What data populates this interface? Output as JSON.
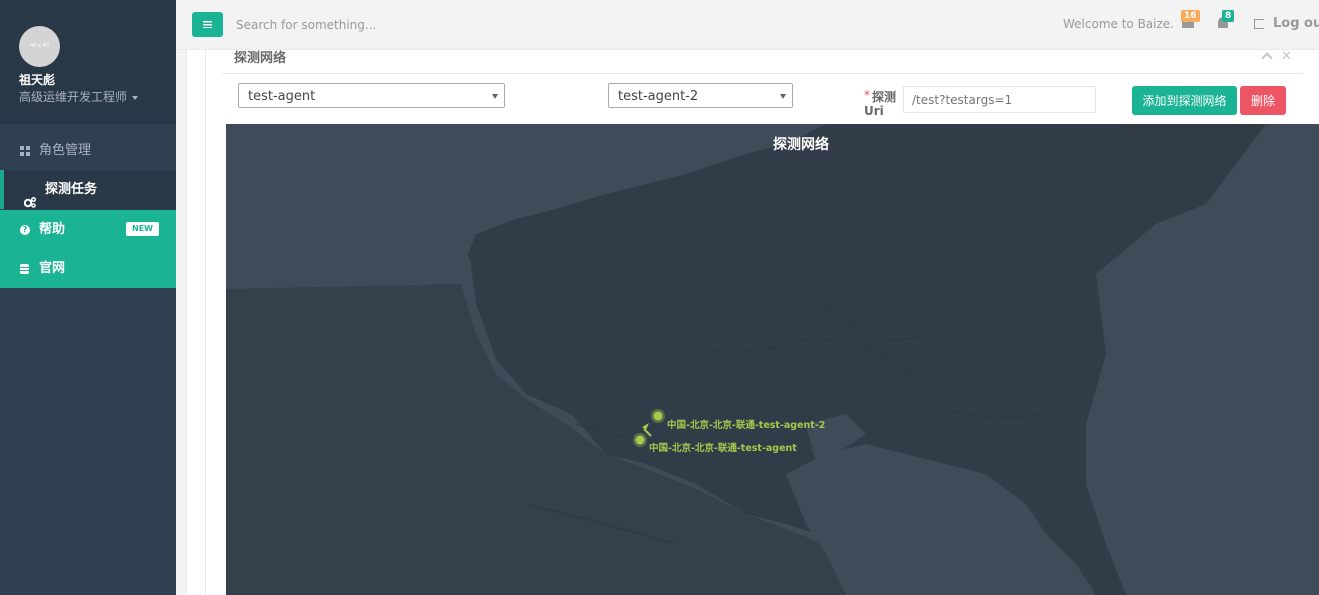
{
  "sidebar": {
    "avatar_text": "40 x 40",
    "user_name": "祖天彪",
    "user_role": "高级运维开发工程师",
    "items": [
      {
        "label": "角色管理",
        "icon": "grid-icon"
      },
      {
        "label": "探测任务",
        "icon": "gears-icon"
      },
      {
        "label": "帮助",
        "icon": "question-icon",
        "badge": "NEW"
      },
      {
        "label": "官网",
        "icon": "database-icon"
      }
    ]
  },
  "topbar": {
    "search_placeholder": "Search for something...",
    "welcome": "Welcome to Baize.",
    "mail_count": "16",
    "alert_count": "8",
    "logout_label": "Log out"
  },
  "panel": {
    "title": "探测网络",
    "agent_from": "test-agent",
    "agent_to": "test-agent-2",
    "uri_label_part1": "探测",
    "uri_label_part2": "Uri",
    "uri_placeholder": "/test?testargs=1",
    "add_button": "添加到探测网络",
    "delete_button": "删除"
  },
  "map": {
    "title": "探测网络",
    "nodes": [
      {
        "label": "中国-北京-北京-联通-test-agent-2"
      },
      {
        "label": "中国-北京-北京-联通-test-agent"
      }
    ],
    "colors": {
      "background": "#404a59",
      "land": "#323c48",
      "node": "#a6c84c"
    }
  }
}
